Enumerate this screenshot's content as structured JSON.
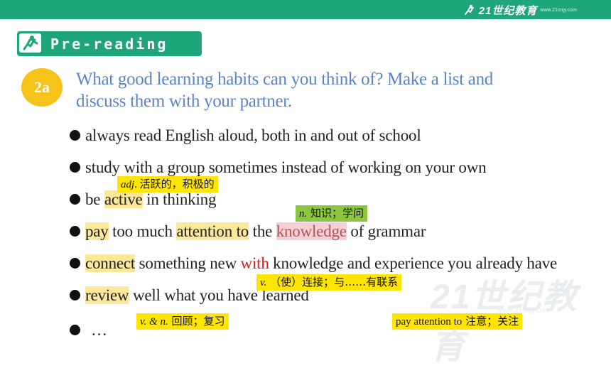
{
  "brand": {
    "logo_text": "21世纪教育",
    "sub_text": "www.21cnjy.com"
  },
  "header": {
    "title": "Pre-reading",
    "icon": "runner-icon"
  },
  "task": {
    "badge": "2a",
    "prompt_line1": "What good learning habits can you think of? Make a list and",
    "prompt_line2": "discuss them with your partner."
  },
  "bullets": [
    {
      "text": "always read English aloud, both in and out of school"
    },
    {
      "text": "study with a group sometimes instead of working on your own"
    },
    {
      "pre": "be ",
      "hl": "active",
      "post": " in thinking"
    },
    {
      "hl1": "pay",
      "mid1": " too much ",
      "hl2": "attention to",
      "mid2": " the ",
      "hl3": "knowledge",
      "post": " of grammar"
    },
    {
      "hl": "connect",
      "mid1": " something new ",
      "red": "with",
      "post": " knowledge and experience you already have"
    },
    {
      "hl": "review",
      "post": " well what you have learned"
    },
    {
      "text": "…"
    }
  ],
  "notes": {
    "active_pos": "adj",
    "active_meaning": "活跃的，积极的",
    "knowledge_pos": "n.",
    "knowledge_meaning": "知识；学问",
    "connect_pos": "v.",
    "connect_meaning": "（使）连接；与……有联系",
    "review_pos": "v. & n.",
    "review_meaning": "回顾；复习",
    "pay_phrase": "pay attention to",
    "pay_meaning": "注意；关注"
  },
  "watermark": {
    "text": "21世纪教育",
    "sub": "www.21cnjy.com"
  },
  "colors": {
    "accent": "#1ea67a",
    "badge": "#f7c21a",
    "prompt": "#5b83c8",
    "highlight": "#fbe89a",
    "note_yellow": "#ffe500",
    "note_green": "#8cc63f"
  }
}
